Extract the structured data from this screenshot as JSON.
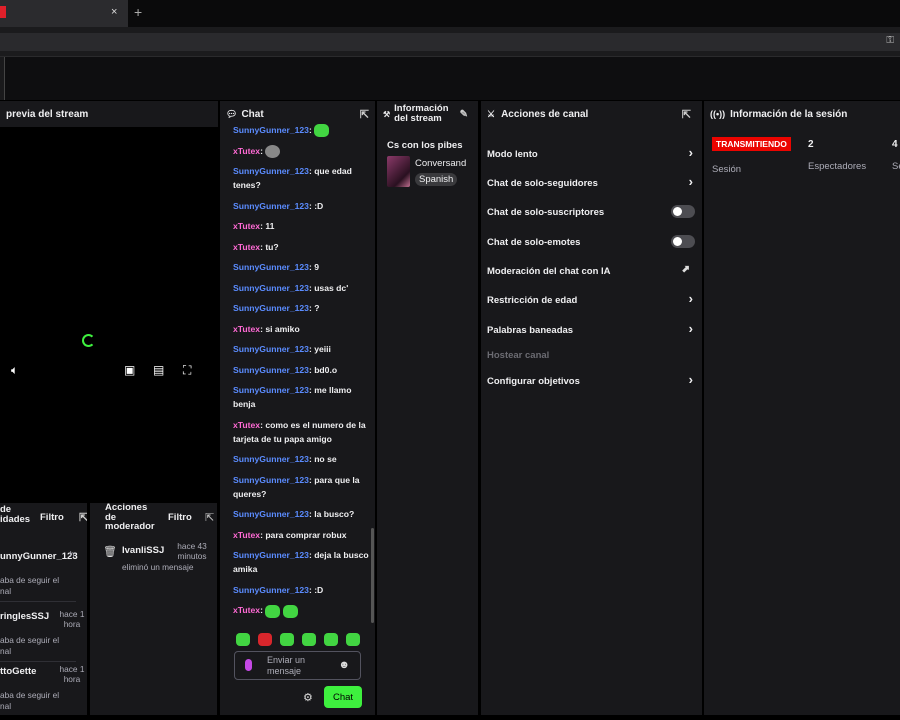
{
  "browser": {
    "tab_close": "×",
    "tab_new": "+",
    "key_icon": "key-icon"
  },
  "preview": {
    "title": "previa del stream",
    "popout_icon": "popout-icon"
  },
  "chat": {
    "title": "Chat",
    "messages": [
      {
        "user": "SunnyGunner_123",
        "text": "",
        "emotes": 1,
        "color": "blue"
      },
      {
        "user": "xTutex",
        "text": "",
        "emotes": 1,
        "color": "pink",
        "gray": true
      },
      {
        "user": "SunnyGunner_123",
        "text": "que edad tenes?",
        "color": "blue"
      },
      {
        "user": "SunnyGunner_123",
        "text": ":D",
        "color": "blue"
      },
      {
        "user": "xTutex",
        "text": "11",
        "color": "pink"
      },
      {
        "user": "xTutex",
        "text": "tu?",
        "color": "pink"
      },
      {
        "user": "SunnyGunner_123",
        "text": "9",
        "color": "blue"
      },
      {
        "user": "SunnyGunner_123",
        "text": "usas dc'",
        "color": "blue"
      },
      {
        "user": "SunnyGunner_123",
        "text": "?",
        "color": "blue"
      },
      {
        "user": "xTutex",
        "text": "si amiko",
        "color": "pink"
      },
      {
        "user": "SunnyGunner_123",
        "text": "yeiii",
        "color": "blue"
      },
      {
        "user": "SunnyGunner_123",
        "text": "bd0.o",
        "color": "blue"
      },
      {
        "user": "SunnyGunner_123",
        "text": "me llamo benja",
        "color": "blue"
      },
      {
        "user": "xTutex",
        "text": "como es el numero de la tarjeta de tu papa amigo",
        "color": "pink"
      },
      {
        "user": "SunnyGunner_123",
        "text": "no se",
        "color": "blue"
      },
      {
        "user": "SunnyGunner_123",
        "text": "para que la queres?",
        "color": "blue"
      },
      {
        "user": "SunnyGunner_123",
        "text": "la busco?",
        "color": "blue"
      },
      {
        "user": "xTutex",
        "text": "para comprar robux",
        "color": "pink"
      },
      {
        "user": "SunnyGunner_123",
        "text": "deja la busco amika",
        "color": "blue"
      },
      {
        "user": "SunnyGunner_123",
        "text": ":D",
        "color": "blue"
      },
      {
        "user": "xTutex",
        "text": "",
        "emotes": 2,
        "color": "pink"
      }
    ],
    "input_placeholder": "Enviar un mensaje",
    "send_label": "Chat"
  },
  "stream_info": {
    "title": "Información del stream",
    "stream_title": "Cs con los pibes",
    "category": "Conversand",
    "tag": "Spanish"
  },
  "actions": {
    "title": "Acciones de canal",
    "items": [
      {
        "label": "Modo lento",
        "control": "chevron"
      },
      {
        "label": "Chat de solo-seguidores",
        "control": "chevron"
      },
      {
        "label": "Chat de solo-suscriptores",
        "control": "toggle",
        "on": false
      },
      {
        "label": "Chat de solo-emotes",
        "control": "toggle",
        "on": false
      },
      {
        "label": "Moderación del chat con IA",
        "control": "chart"
      },
      {
        "label": "Restricción de edad",
        "control": "chevron"
      },
      {
        "label": "Palabras baneadas",
        "control": "chevron"
      },
      {
        "label": "Hostear canal",
        "control": "none",
        "disabled": true
      },
      {
        "label": "Configurar objetivos",
        "control": "chevron"
      }
    ]
  },
  "session": {
    "title": "Información de la sesión",
    "live_badge": "TRANSMITIENDO",
    "session_label": "Sesión",
    "viewers": "2",
    "viewers_label": "Espectadores",
    "third_value": "4",
    "third_label": "Se"
  },
  "feed": {
    "title": "de\nidades",
    "filter": "Filtro",
    "items": [
      {
        "name": "unnyGunner_123",
        "sub": "aba de seguir el nal",
        "time": "h"
      },
      {
        "name": "ringlesSSJ",
        "sub": "aba de seguir el nal",
        "time": "hace 1 hora"
      },
      {
        "name": "ttoGette",
        "sub": "aba de seguir el nal",
        "time": "hace 1 hora"
      }
    ]
  },
  "mod": {
    "title": "Acciones de moderador",
    "filter": "Filtro",
    "user": "IvanliSSJ",
    "time": "hace 43 minutos",
    "action": "eliminó un mensaje"
  }
}
